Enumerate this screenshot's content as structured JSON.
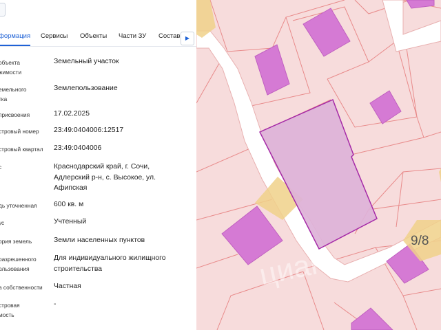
{
  "tabs": [
    {
      "label": "формация",
      "active": true
    },
    {
      "label": "Сервисы",
      "active": false
    },
    {
      "label": "Объекты",
      "active": false
    },
    {
      "label": "Части ЗУ",
      "active": false
    },
    {
      "label": "Состав",
      "active": false
    }
  ],
  "tab_arrow_icon": "chevron-right-icon",
  "fields": [
    {
      "label": "объекта\nжимости",
      "value": "Земельный участок"
    },
    {
      "label": "емельного\nтка",
      "value": "Землепользование"
    },
    {
      "label": "присвоения",
      "value": "17.02.2025"
    },
    {
      "label": "стровый номер",
      "value": "23:49:0404006:12517"
    },
    {
      "label": "стровый квартал",
      "value": "23:49:0404006"
    },
    {
      "label": "с",
      "value": "Краснодарский край, г. Сочи, Адлерский р-н, с. Высокое, ул. Афипская"
    },
    {
      "label": "дь уточненная",
      "value": "600 кв. м"
    },
    {
      "label": "ус",
      "value": "Учтенный"
    },
    {
      "label": "ория земель",
      "value": "Земли населенных пунктов"
    },
    {
      "label": "разрешенного\nользования",
      "value": "Для индивидуального жилищного строительства"
    },
    {
      "label": "а собственности",
      "value": "Частная"
    },
    {
      "label": "стровая\nмость",
      "value": "-"
    }
  ],
  "map": {
    "parcel_label": "9/8",
    "watermark": "циан",
    "colors": {
      "background": "#f7dcdc",
      "parcel_border": "#e88a8a",
      "building": "#d57ad4",
      "selected_fill": "#ddb2d8",
      "selected_border": "#a52aa7",
      "road": "#ffffff",
      "yellow_marker": "#f0d18a"
    }
  }
}
